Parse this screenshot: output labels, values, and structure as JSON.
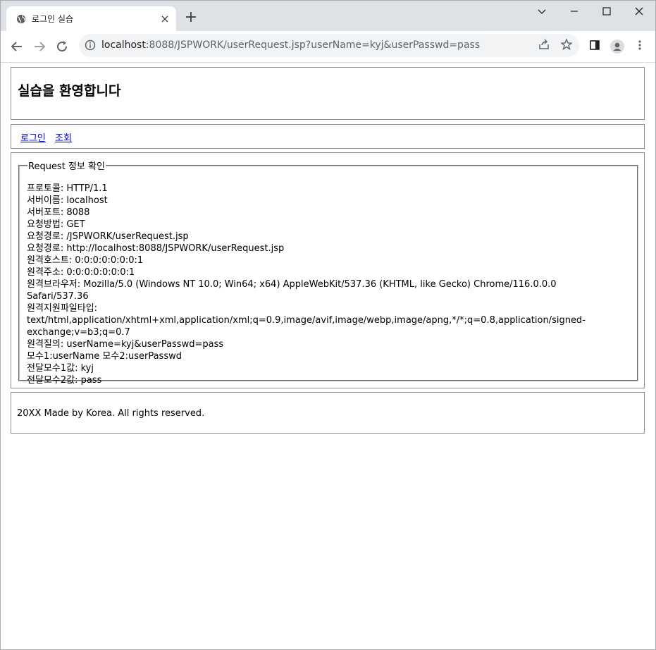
{
  "browser": {
    "tab_title": "로그인 실습",
    "tab_close": "×",
    "new_tab": "+",
    "url_host": "localhost",
    "url_rest": ":8088/JSPWORK/userRequest.jsp?userName=kyj&userPasswd=pass",
    "icons": [
      "globe-icon",
      "close-icon",
      "plus-icon",
      "chevron-down-icon",
      "minimize-icon",
      "maximize-icon",
      "window-close-icon",
      "back-icon",
      "forward-icon",
      "reload-icon",
      "info-icon",
      "share-icon",
      "star-icon",
      "side-panel-icon",
      "profile-icon",
      "menu-icon"
    ]
  },
  "page": {
    "header_title": "실습을 환영합니다",
    "nav": [
      {
        "label": "로그인"
      },
      {
        "label": "조회"
      }
    ],
    "legend": "Request 정보 확인",
    "lines": [
      "프로토콜: HTTP/1.1",
      "서버이름: localhost",
      "서버포트: 8088",
      "요청방법: GET",
      "요청경로: /JSPWORK/userRequest.jsp",
      "요청경로: http://localhost:8088/JSPWORK/userRequest.jsp",
      "원격호스트: 0:0:0:0:0:0:0:1",
      "원격주소: 0:0:0:0:0:0:0:1",
      "원격브라우저: Mozilla/5.0 (Windows NT 10.0; Win64; x64) AppleWebKit/537.36 (KHTML, like Gecko) Chrome/116.0.0.0 Safari/537.36",
      "원격지원파일타입: text/html,application/xhtml+xml,application/xml;q=0.9,image/avif,image/webp,image/apng,*/*;q=0.8,application/signed-exchange;v=b3;q=0.7",
      "원격질의: userName=kyj&userPasswd=pass",
      "모수1:userName 모수2:userPasswd",
      "전달모수1값: kyj",
      "전달모수2값: pass"
    ],
    "footer": "20XX Made by Korea. All rights reserved."
  }
}
